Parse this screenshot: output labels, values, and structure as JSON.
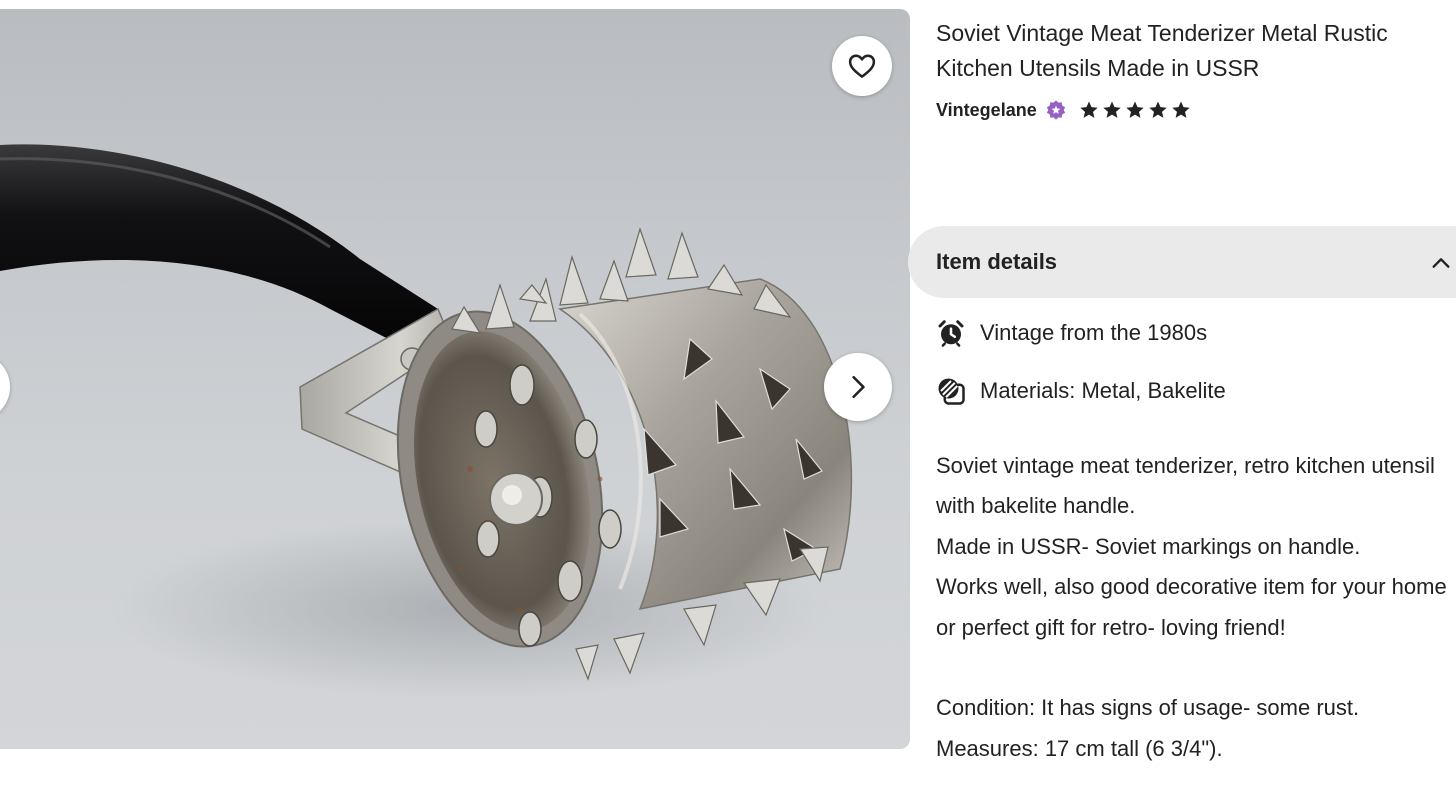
{
  "listing": {
    "title": "Soviet Vintage Meat Tenderizer Metal Rustic Kitchen Utensils Made in USSR",
    "seller_name": "Vintegelane",
    "rating_stars": 5,
    "rating_max": 5
  },
  "image_panel": {
    "favorite_icon": "heart-outline-icon",
    "next_icon": "chevron-right-icon",
    "prev_icon": "chevron-left-icon"
  },
  "item_details": {
    "header_label": "Item details",
    "toggle_icon": "chevron-up-icon",
    "highlights": [
      {
        "icon": "alarm-clock-icon",
        "text": "Vintage from the 1980s"
      },
      {
        "icon": "materials-icon",
        "text": "Materials: Metal, Bakelite"
      }
    ],
    "description_lines": [
      "Soviet vintage meat tenderizer, retro kitchen utensil with bakelite handle.",
      "Made in USSR- Soviet markings on handle.",
      "Works well, also good decorative item for your home or perfect gift for retro- loving friend!",
      "",
      "Condition: It has signs of usage- some rust.",
      "Measures: 17 cm tall (6 3/4\")."
    ]
  },
  "colors": {
    "text": "#222222",
    "details_header_bg": "#eaeaea",
    "star": "#222222",
    "star_seller_badge": "#9560c8",
    "button_bg": "#ffffff"
  }
}
